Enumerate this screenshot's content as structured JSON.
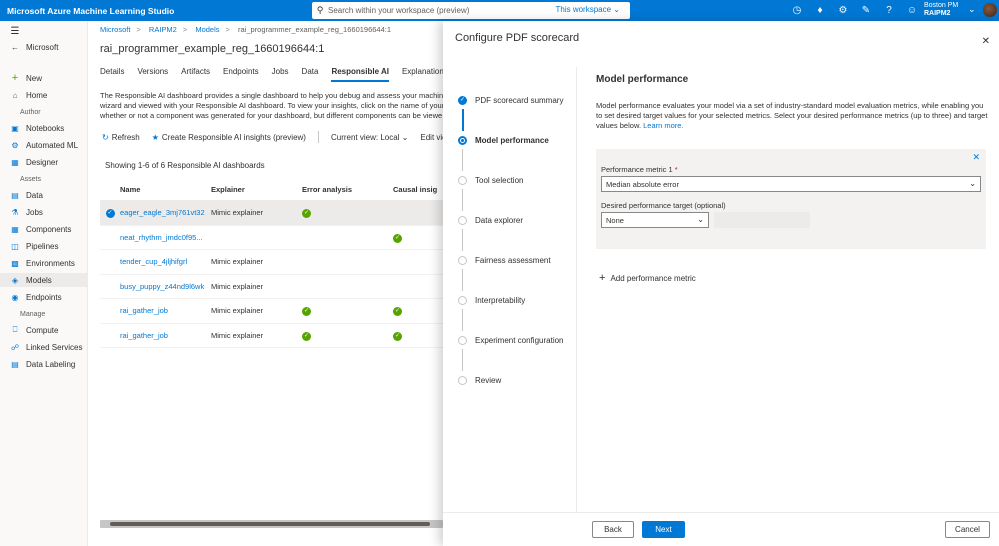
{
  "app": {
    "title": "Microsoft Azure Machine Learning Studio",
    "search_placeholder": "Search within your workspace (preview)",
    "search_scope": "This workspace",
    "user_name": "Boston PM",
    "user_workspace": "RAIPM2"
  },
  "leftnav": {
    "top_items": [
      {
        "label": "Microsoft",
        "icon": "back-arrow-icon"
      },
      {
        "label": "New",
        "icon": "plus-icon"
      },
      {
        "label": "Home",
        "icon": "home-icon"
      }
    ],
    "author_label": "Author",
    "author_items": [
      {
        "label": "Notebooks",
        "icon": "notebook-icon"
      },
      {
        "label": "Automated ML",
        "icon": "automl-icon"
      },
      {
        "label": "Designer",
        "icon": "designer-icon"
      }
    ],
    "assets_label": "Assets",
    "assets_items": [
      {
        "label": "Data",
        "icon": "data-icon"
      },
      {
        "label": "Jobs",
        "icon": "jobs-icon"
      },
      {
        "label": "Components",
        "icon": "components-icon"
      },
      {
        "label": "Pipelines",
        "icon": "pipelines-icon"
      },
      {
        "label": "Environments",
        "icon": "environments-icon"
      },
      {
        "label": "Models",
        "icon": "models-icon"
      },
      {
        "label": "Endpoints",
        "icon": "endpoints-icon"
      }
    ],
    "manage_label": "Manage",
    "manage_items": [
      {
        "label": "Compute",
        "icon": "compute-icon"
      },
      {
        "label": "Linked Services",
        "icon": "link-icon"
      },
      {
        "label": "Data Labeling",
        "icon": "labeling-icon"
      }
    ]
  },
  "main": {
    "breadcrumb": [
      "Microsoft",
      "RAIPM2",
      "Models",
      "rai_programmer_example_reg_1660196644:1"
    ],
    "title": "rai_programmer_example_reg_1660196644:1",
    "tabs": [
      "Details",
      "Versions",
      "Artifacts",
      "Endpoints",
      "Jobs",
      "Data",
      "Responsible AI",
      "Explanations"
    ],
    "description_lines": [
      "The Responsible AI dashboard provides a single dashboard to help you debug and assess your machine",
      "wizard and viewed with your Responsible AI dashboard. To view your insights, click on the name of your",
      "whether or not a component was generated for your dashboard, but different components can be viewe"
    ],
    "toolbar": {
      "refresh": "Refresh",
      "create": "Create Responsible AI insights (preview)",
      "current_view_label": "Current view:",
      "current_view_value": "Local",
      "edit_view": "Edit view"
    },
    "showing": "Showing 1-6 of 6 Responsible AI dashboards",
    "columns": [
      "Name",
      "Explainer",
      "Error analysis",
      "Causal insig"
    ],
    "rows": [
      {
        "name": "eager_eagle_3mj761vt32",
        "explainer": "Mimic explainer",
        "error": true,
        "causal": false
      },
      {
        "name": "neat_rhythm_jmdc0f95...",
        "explainer": "",
        "error": false,
        "causal": true
      },
      {
        "name": "tender_cup_4jljhifgrl",
        "explainer": "Mimic explainer",
        "error": false,
        "causal": false
      },
      {
        "name": "busy_puppy_z44nd9l6wk",
        "explainer": "Mimic explainer",
        "error": false,
        "causal": false
      },
      {
        "name": "rai_gather_job",
        "explainer": "Mimic explainer",
        "error": true,
        "causal": true
      },
      {
        "name": "rai_gather_job",
        "explainer": "Mimic explainer",
        "error": true,
        "causal": true
      }
    ]
  },
  "panel": {
    "title": "Configure PDF scorecard",
    "steps": [
      {
        "label": "PDF scorecard summary",
        "state": "done"
      },
      {
        "label": "Model performance",
        "state": "current"
      },
      {
        "label": "Tool selection",
        "state": "todo"
      },
      {
        "label": "Data explorer",
        "state": "todo"
      },
      {
        "label": "Fairness assessment",
        "state": "todo"
      },
      {
        "label": "Interpretability",
        "state": "todo"
      },
      {
        "label": "Experiment configuration",
        "state": "todo"
      },
      {
        "label": "Review",
        "state": "todo"
      }
    ],
    "section_title": "Model performance",
    "section_desc_1": "Model performance evaluates your model via a set of industry-standard model evaluation metrics, while enabling you",
    "section_desc_2": "to set desired target values for your selected metrics. Select your desired performance metrics (up to three) and target",
    "section_desc_3": "values below.",
    "learn_more": "Learn more.",
    "metric_label": "Performance metric 1",
    "metric_required": "*",
    "metric_value": "Median absolute error",
    "target_label": "Desired performance target (optional)",
    "target_value": "None",
    "add_metric": "Add performance metric",
    "back": "Back",
    "next": "Next",
    "cancel": "Cancel"
  },
  "colors": {
    "accent": "#0078d4",
    "success": "#57a300"
  }
}
